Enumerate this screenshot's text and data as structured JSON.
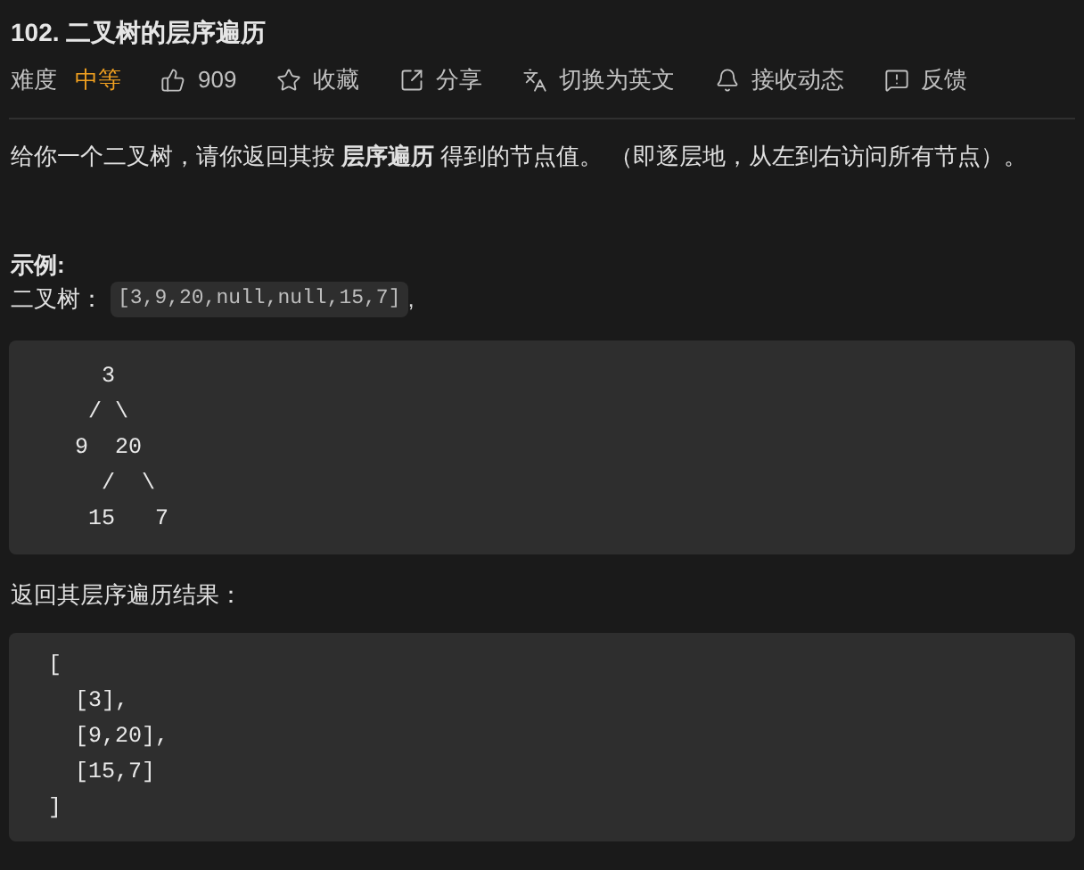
{
  "title": "102. 二叉树的层序遍历",
  "toolbar": {
    "difficulty_label": "难度",
    "difficulty": "中等",
    "actions": [
      {
        "kind": "like",
        "label": "909"
      },
      {
        "kind": "favorite",
        "label": "收藏"
      },
      {
        "kind": "share",
        "label": "分享"
      },
      {
        "kind": "translate",
        "label": "切换为英文"
      },
      {
        "kind": "subscribe",
        "label": "接收动态"
      },
      {
        "kind": "feedback",
        "label": "反馈"
      }
    ]
  },
  "description": "给你一个二叉树，请你返回其按 **层序遍历** 得到的节点值。 （即逐层地，从左到右访问所有节点）。",
  "example": {
    "heading": "示例:",
    "input_label": "二叉树：",
    "input_code": "[3,9,20,null,null,15,7]",
    "input_suffix": ",",
    "tree_lines": [
      "    3",
      "   / \\",
      "  9  20",
      "    /  \\",
      "   15   7"
    ],
    "result_label": "返回其层序遍历结果：",
    "result_lines": [
      "[",
      "  [3],",
      "  [9,20],",
      "  [15,7]",
      "]"
    ]
  }
}
